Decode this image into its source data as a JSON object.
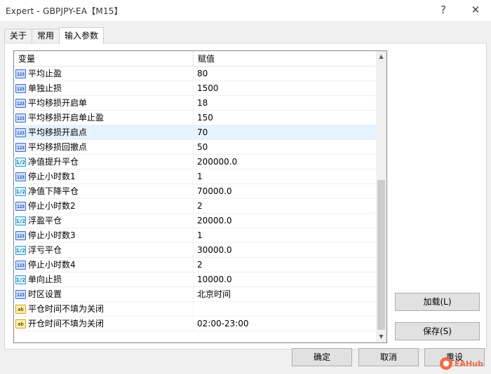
{
  "window": {
    "title": "Expert - GBPJPY-EA【M15】",
    "help_glyph": "?",
    "close_glyph": "✕"
  },
  "tabs": [
    {
      "label": "关于"
    },
    {
      "label": "常用"
    },
    {
      "label": "输入参数"
    }
  ],
  "grid": {
    "columns": {
      "variable": "变量",
      "value": "赋值"
    },
    "rows": [
      {
        "name": "平均止盈",
        "value": "80",
        "type": "int"
      },
      {
        "name": "单独止损",
        "value": "1500",
        "type": "int"
      },
      {
        "name": "平均移损开启单",
        "value": "18",
        "type": "int"
      },
      {
        "name": "平均移损开启单止盈",
        "value": "150",
        "type": "int"
      },
      {
        "name": "平均移损开启点",
        "value": "70",
        "type": "int",
        "selected": true
      },
      {
        "name": "平均移损回撤点",
        "value": "50",
        "type": "int"
      },
      {
        "name": "净值提升平仓",
        "value": "200000.0",
        "type": "double"
      },
      {
        "name": "停止小时数1",
        "value": "1",
        "type": "int"
      },
      {
        "name": "净值下降平仓",
        "value": "70000.0",
        "type": "double"
      },
      {
        "name": "停止小时数2",
        "value": "2",
        "type": "int"
      },
      {
        "name": "浮盈平仓",
        "value": "20000.0",
        "type": "double"
      },
      {
        "name": "停止小时数3",
        "value": "1",
        "type": "int"
      },
      {
        "name": "浮亏平仓",
        "value": "30000.0",
        "type": "double"
      },
      {
        "name": "停止小时数4",
        "value": "2",
        "type": "int"
      },
      {
        "name": "单向止损",
        "value": "10000.0",
        "type": "double"
      },
      {
        "name": "时区设置",
        "value": "北京时间",
        "type": "int"
      },
      {
        "name": "平仓时间不填为关闭",
        "value": "",
        "type": "string"
      },
      {
        "name": "开仓时间不填为关闭",
        "value": "02:00-23:00",
        "type": "string"
      }
    ]
  },
  "icons": {
    "int": "123",
    "double": "1/2",
    "string": "ab"
  },
  "buttons": {
    "load": "加载(L)",
    "save": "保存(S)",
    "ok": "确定",
    "cancel": "取消",
    "reset": "重设"
  },
  "watermark": {
    "text": "EAHub"
  },
  "colors": {
    "selected_row": "#e5f3ff",
    "watermark": "#f06a4a"
  }
}
